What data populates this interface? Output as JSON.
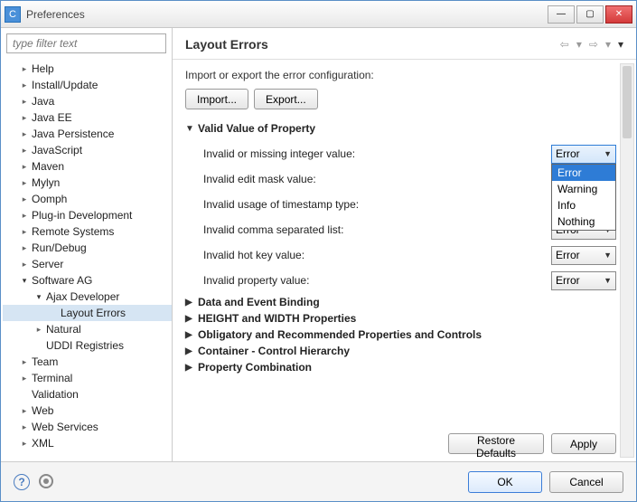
{
  "title": "Preferences",
  "filter_placeholder": "type filter text",
  "tree": [
    {
      "label": "Help",
      "indent": 1,
      "tw": "closed"
    },
    {
      "label": "Install/Update",
      "indent": 1,
      "tw": "closed"
    },
    {
      "label": "Java",
      "indent": 1,
      "tw": "closed"
    },
    {
      "label": "Java EE",
      "indent": 1,
      "tw": "closed"
    },
    {
      "label": "Java Persistence",
      "indent": 1,
      "tw": "closed"
    },
    {
      "label": "JavaScript",
      "indent": 1,
      "tw": "closed"
    },
    {
      "label": "Maven",
      "indent": 1,
      "tw": "closed"
    },
    {
      "label": "Mylyn",
      "indent": 1,
      "tw": "closed"
    },
    {
      "label": "Oomph",
      "indent": 1,
      "tw": "closed"
    },
    {
      "label": "Plug-in Development",
      "indent": 1,
      "tw": "closed"
    },
    {
      "label": "Remote Systems",
      "indent": 1,
      "tw": "closed"
    },
    {
      "label": "Run/Debug",
      "indent": 1,
      "tw": "closed"
    },
    {
      "label": "Server",
      "indent": 1,
      "tw": "closed"
    },
    {
      "label": "Software AG",
      "indent": 1,
      "tw": "open"
    },
    {
      "label": "Ajax Developer",
      "indent": 2,
      "tw": "open"
    },
    {
      "label": "Layout Errors",
      "indent": 3,
      "tw": "none",
      "selected": true
    },
    {
      "label": "Natural",
      "indent": 2,
      "tw": "closed"
    },
    {
      "label": "UDDI Registries",
      "indent": 2,
      "tw": "none"
    },
    {
      "label": "Team",
      "indent": 1,
      "tw": "closed"
    },
    {
      "label": "Terminal",
      "indent": 1,
      "tw": "closed"
    },
    {
      "label": "Validation",
      "indent": 1,
      "tw": "none"
    },
    {
      "label": "Web",
      "indent": 1,
      "tw": "closed"
    },
    {
      "label": "Web Services",
      "indent": 1,
      "tw": "closed"
    },
    {
      "label": "XML",
      "indent": 1,
      "tw": "closed"
    }
  ],
  "page_title": "Layout Errors",
  "description": "Import or export the error configuration:",
  "buttons": {
    "import": "Import...",
    "export": "Export...",
    "restore": "Restore Defaults",
    "apply": "Apply",
    "ok": "OK",
    "cancel": "Cancel"
  },
  "sections": {
    "valid_value": "Valid Value of Property",
    "data_event": "Data and Event Binding",
    "height_width": "HEIGHT and WIDTH Properties",
    "obligatory": "Obligatory and Recommended Properties and Controls",
    "container": "Container - Control Hierarchy",
    "combination": "Property Combination"
  },
  "props": [
    {
      "label": "Invalid or missing integer value:",
      "value": "Error",
      "active": true
    },
    {
      "label": "Invalid edit mask value:",
      "value": "Error"
    },
    {
      "label": "Invalid usage of timestamp type:",
      "value": "Error"
    },
    {
      "label": "Invalid comma separated list:",
      "value": "Error"
    },
    {
      "label": "Invalid hot key value:",
      "value": "Error"
    },
    {
      "label": "Invalid property value:",
      "value": "Error"
    }
  ],
  "dropdown_options": [
    "Error",
    "Warning",
    "Info",
    "Nothing"
  ]
}
